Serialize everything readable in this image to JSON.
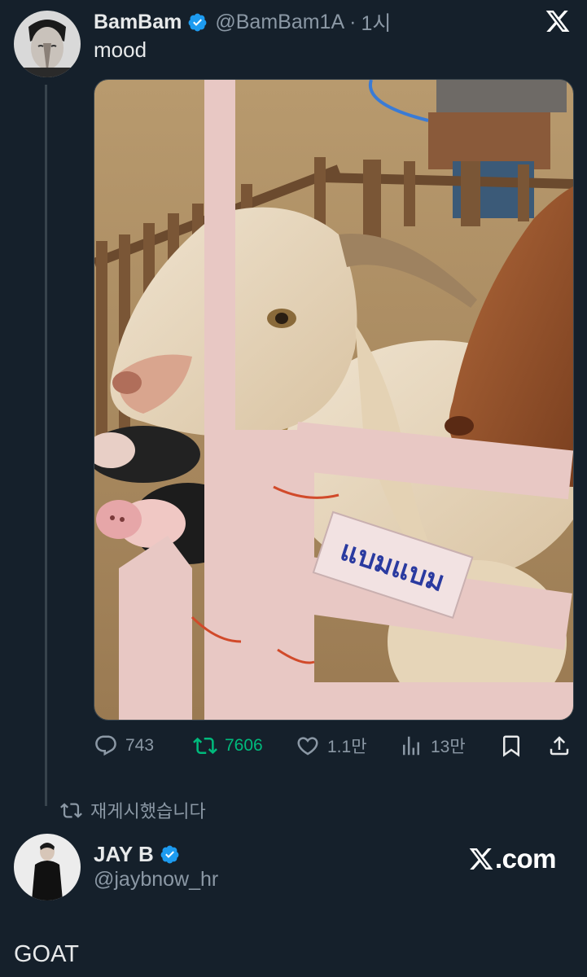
{
  "tweet": {
    "author": {
      "display_name": "BamBam",
      "handle": "@BamBam1A",
      "verified": true,
      "avatar_icon": "avatar-photo"
    },
    "separator": "·",
    "time": "1시",
    "text": "mood",
    "media": {
      "icon": "goat-pig-photo",
      "sign_text": "แบมแบม"
    },
    "actions": {
      "replies": "743",
      "retweets": "7606",
      "likes": "1.1만",
      "views": "13만"
    }
  },
  "repost": {
    "label": "재게시했습니다"
  },
  "reposter": {
    "display_name": "JAY B",
    "handle": "@jaybnow_hr",
    "verified": true,
    "avatar_icon": "avatar-photo"
  },
  "brand": {
    "site": ".com"
  },
  "caption": "GOAT",
  "colors": {
    "background": "#15202b",
    "text": "#e7e9ea",
    "muted": "#8b98a5",
    "verified": "#1d9bf0",
    "retweet_active": "#00ba7c"
  }
}
